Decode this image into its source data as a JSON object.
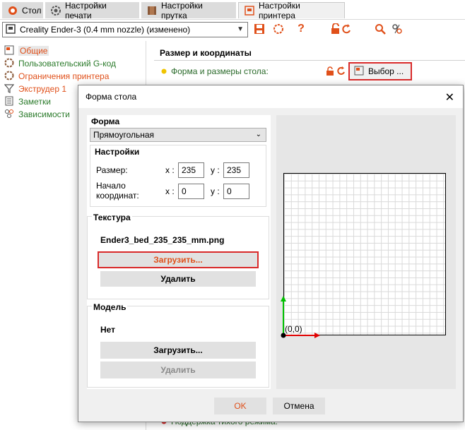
{
  "tabs": [
    {
      "label": "Стол",
      "icon": "plate-icon"
    },
    {
      "label": "Настройки печати",
      "icon": "gear-icon"
    },
    {
      "label": "Настройки прутка",
      "icon": "spool-icon"
    },
    {
      "label": "Настройки принтера",
      "icon": "printer-icon"
    }
  ],
  "toolbar": {
    "printer_preset": "Creality Ender-3 (0.4 mm nozzle) (изменено)"
  },
  "sidebar": {
    "items": [
      {
        "label": "Общие",
        "color": "#e0501a"
      },
      {
        "label": "Пользовательский G-код",
        "color": "#2a7a2a"
      },
      {
        "label": "Ограничения принтера",
        "color": "#e0501a"
      },
      {
        "label": "Экструдер 1",
        "color": "#e0501a"
      },
      {
        "label": "Заметки",
        "color": "#2a7a2a"
      },
      {
        "label": "Зависимости",
        "color": "#2a7a2a"
      }
    ]
  },
  "main": {
    "section_title": "Размер и координаты",
    "bed_shape_label": "Форма и размеры стола:",
    "choose_button": "Выбор ...",
    "quiet_mode_label": "Поддержка тихого режима:"
  },
  "dialog": {
    "title": "Форма стола",
    "shape_group": "Форма",
    "shape_value": "Прямоугольная",
    "settings_group": "Настройки",
    "size_label": "Размер:",
    "origin_label_1": "Начало",
    "origin_label_2": "координат:",
    "x_label": "x :",
    "y_label": "y :",
    "size_x": "235",
    "size_y": "235",
    "origin_x": "0",
    "origin_y": "0",
    "texture_group": "Текстура",
    "texture_file": "Ender3_bed_235_235_mm.png",
    "texture_load": "Загрузить...",
    "texture_remove": "Удалить",
    "model_group": "Модель",
    "model_value": "Нет",
    "model_load": "Загрузить...",
    "model_remove": "Удалить",
    "origin_text": "(0,0)",
    "ok": "OK",
    "cancel": "Отмена"
  }
}
